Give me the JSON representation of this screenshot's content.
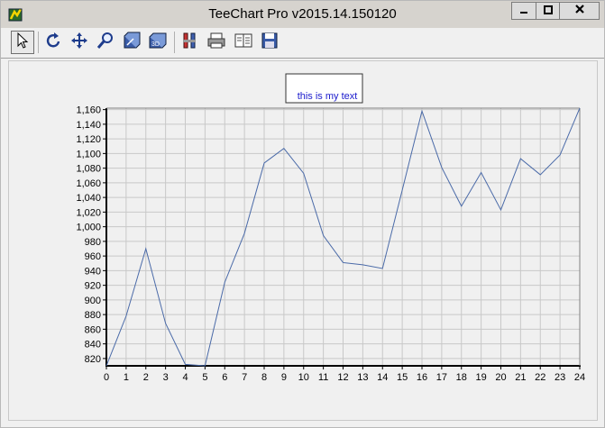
{
  "window": {
    "title": "TeeChart Pro v2015.14.150120",
    "minimize_icon": "minimize-icon",
    "maximize_icon": "maximize-icon",
    "close_icon": "close-icon"
  },
  "toolbar": {
    "buttons": [
      {
        "name": "select",
        "icon": "pointer-arrow-icon",
        "active": true
      },
      {
        "name": "rotate",
        "icon": "rotate-icon"
      },
      {
        "name": "move",
        "icon": "move-arrows-icon"
      },
      {
        "name": "zoom",
        "icon": "magnifier-icon"
      },
      {
        "name": "depth",
        "icon": "depth-3d-icon"
      },
      {
        "name": "view3d",
        "icon": "view-3d-icon"
      },
      {
        "name": "editor",
        "icon": "chart-editor-icon"
      },
      {
        "name": "print",
        "icon": "printer-icon"
      },
      {
        "name": "export",
        "icon": "export-icon"
      },
      {
        "name": "save",
        "icon": "floppy-disk-icon"
      }
    ]
  },
  "annotation": {
    "text": "this is my text",
    "color": "#1a1acc"
  },
  "chart_data": {
    "type": "line",
    "title": "",
    "xlabel": "",
    "ylabel": "",
    "x": [
      0,
      1,
      2,
      3,
      4,
      5,
      6,
      7,
      8,
      9,
      10,
      11,
      12,
      13,
      14,
      15,
      16,
      17,
      18,
      19,
      20,
      21,
      22,
      23,
      24
    ],
    "series": [
      {
        "values": [
          810,
          878,
          970,
          868,
          812,
          810,
          924,
          991,
          1087,
          1107,
          1073,
          988,
          951,
          948,
          943,
          1050,
          1158,
          1081,
          1028,
          1074,
          1023,
          1093,
          1071,
          1098,
          1162
        ],
        "color": "#4a6aa8"
      }
    ],
    "ylim": [
      810,
      1162
    ],
    "xlim": [
      0,
      24
    ],
    "y_ticks": [
      820,
      840,
      860,
      880,
      900,
      920,
      940,
      960,
      980,
      1000,
      1020,
      1040,
      1060,
      1080,
      1100,
      1120,
      1140,
      1160
    ],
    "y_tick_labels": [
      "820",
      "840",
      "860",
      "880",
      "900",
      "920",
      "940",
      "960",
      "980",
      "1,000",
      "1,020",
      "1,040",
      "1,060",
      "1,080",
      "1,100",
      "1,120",
      "1,140",
      "1,160"
    ],
    "x_tick_labels": [
      "0",
      "1",
      "2",
      "3",
      "4",
      "5",
      "6",
      "7",
      "8",
      "9",
      "10",
      "11",
      "12",
      "13",
      "14",
      "15",
      "16",
      "17",
      "18",
      "19",
      "20",
      "21",
      "22",
      "23",
      "24"
    ],
    "grid": true
  }
}
